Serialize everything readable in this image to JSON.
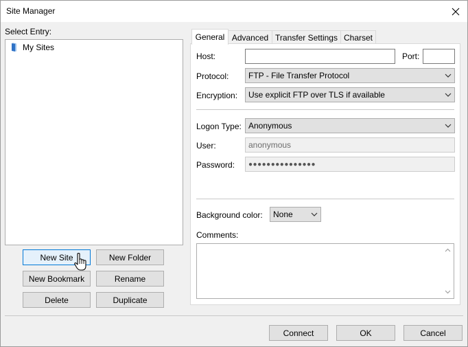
{
  "window": {
    "title": "Site Manager"
  },
  "left": {
    "select_entry_label": "Select Entry:",
    "tree": [
      {
        "label": "My Sites",
        "icon": "folder-icon"
      }
    ],
    "buttons": {
      "new_site": "New Site",
      "new_folder": "New Folder",
      "new_bookmark": "New Bookmark",
      "rename": "Rename",
      "delete": "Delete",
      "duplicate": "Duplicate"
    }
  },
  "tabs": [
    {
      "label": "General",
      "active": true
    },
    {
      "label": "Advanced",
      "active": false
    },
    {
      "label": "Transfer Settings",
      "active": false
    },
    {
      "label": "Charset",
      "active": false
    }
  ],
  "general": {
    "host_label": "Host:",
    "host_value": "",
    "port_label": "Port:",
    "port_value": "",
    "protocol_label": "Protocol:",
    "protocol_value": "FTP - File Transfer Protocol",
    "encryption_label": "Encryption:",
    "encryption_value": "Use explicit FTP over TLS if available",
    "logon_type_label": "Logon Type:",
    "logon_type_value": "Anonymous",
    "user_label": "User:",
    "user_value": "anonymous",
    "password_label": "Password:",
    "password_value": "●●●●●●●●●●●●●●●",
    "background_color_label": "Background color:",
    "background_color_value": "None",
    "comments_label": "Comments:",
    "comments_value": ""
  },
  "footer": {
    "connect": "Connect",
    "ok": "OK",
    "cancel": "Cancel"
  },
  "colors": {
    "window_bg": "#f0f0f0",
    "button_bg": "#e1e1e1",
    "default_button_border": "#0078d7",
    "folder": "#2f72c6"
  }
}
